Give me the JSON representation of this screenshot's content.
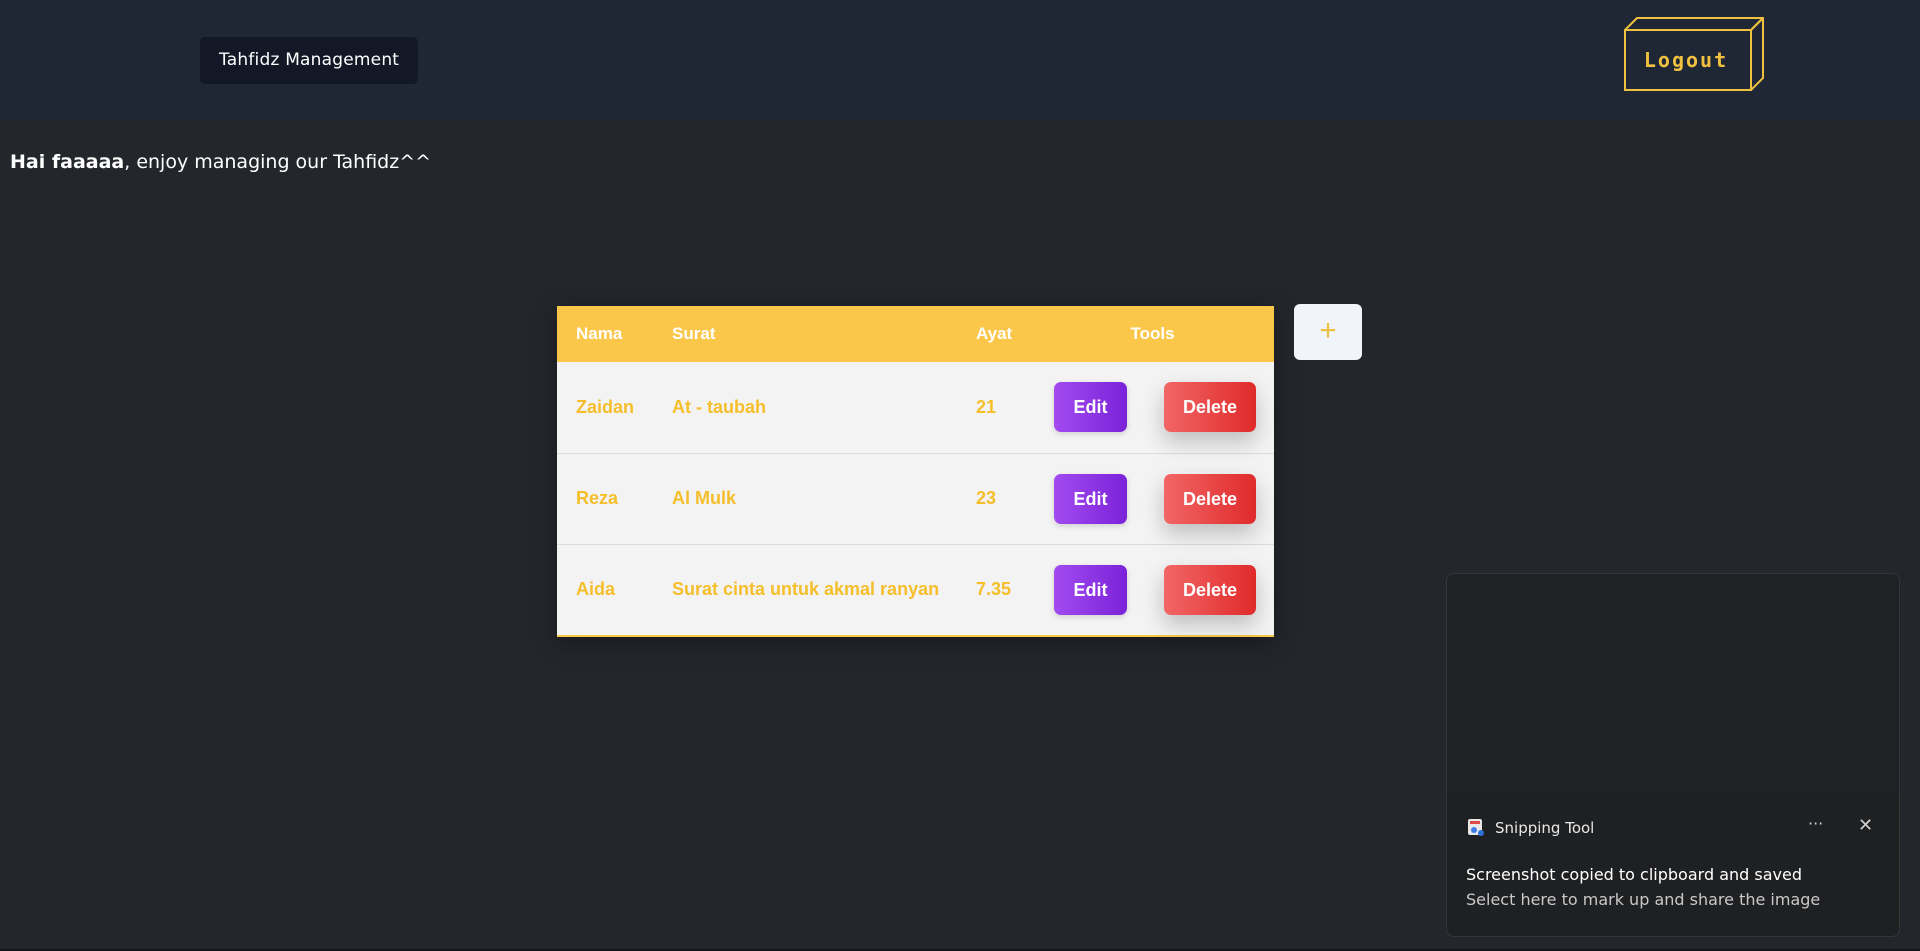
{
  "header": {
    "brand": "Tahfidz Management",
    "logout_label": "Logout"
  },
  "greeting": {
    "name": "Hai faaaaa",
    "message": ", enjoy managing our Tahfidz^^"
  },
  "table": {
    "columns": [
      "Nama",
      "Surat",
      "Ayat",
      "Tools"
    ],
    "rows": [
      {
        "nama": "Zaidan",
        "surat": "At - taubah",
        "ayat": "21"
      },
      {
        "nama": "Reza",
        "surat": "Al Mulk",
        "ayat": "23"
      },
      {
        "nama": "Aida",
        "surat": "Surat cinta untuk akmal ranyan",
        "ayat": "7.35"
      }
    ],
    "edit_label": "Edit",
    "delete_label": "Delete"
  },
  "add_button": {
    "label": "+"
  },
  "toast": {
    "app_name": "Snipping Tool",
    "more_label": "···",
    "close_label": "✕",
    "title": "Screenshot copied to clipboard and saved",
    "body": "Select here to mark up and share the image"
  },
  "colors": {
    "accent": "#fbc74b",
    "edit": "#8a33e6",
    "delete": "#e84545",
    "background": "#23262b",
    "header": "#1f2735"
  },
  "icons": {
    "toast_app": "snipping-tool-icon",
    "more": "more-icon",
    "close": "close-icon",
    "add": "plus-icon"
  }
}
